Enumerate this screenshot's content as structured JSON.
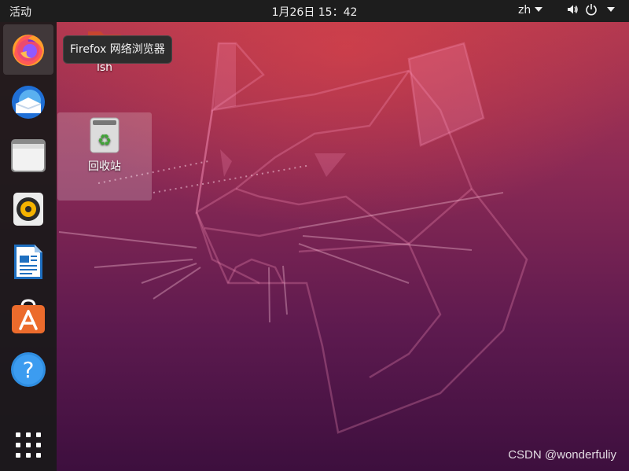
{
  "topbar": {
    "activities": "活动",
    "clock": "1月26日  15：42",
    "language": "zh"
  },
  "tooltip": {
    "text": "Firefox 网络浏览器"
  },
  "dock": {
    "items": [
      {
        "name": "firefox",
        "icon": "firefox-icon",
        "active": true
      },
      {
        "name": "thunderbird",
        "icon": "thunderbird-icon",
        "active": false
      },
      {
        "name": "files",
        "icon": "files-icon",
        "active": false
      },
      {
        "name": "rhythmbox",
        "icon": "rhythmbox-icon",
        "active": false
      },
      {
        "name": "libreoffice-writer",
        "icon": "writer-icon",
        "active": false
      },
      {
        "name": "ubuntu-software",
        "icon": "software-icon",
        "active": false
      },
      {
        "name": "help",
        "icon": "help-icon",
        "active": false
      }
    ],
    "show_apps_icon": "show-applications-icon"
  },
  "desktop": {
    "icons": [
      {
        "label": "lsh",
        "icon": "home-folder-icon"
      },
      {
        "label": "回收站",
        "icon": "trash-icon"
      }
    ]
  },
  "watermark": "CSDN @wonderfuliy",
  "colors": {
    "topbar": "#1d1d1d",
    "dock": "#191919",
    "wallpaper_top": "#b83b4f",
    "wallpaper_bottom": "#3d0f3e"
  }
}
